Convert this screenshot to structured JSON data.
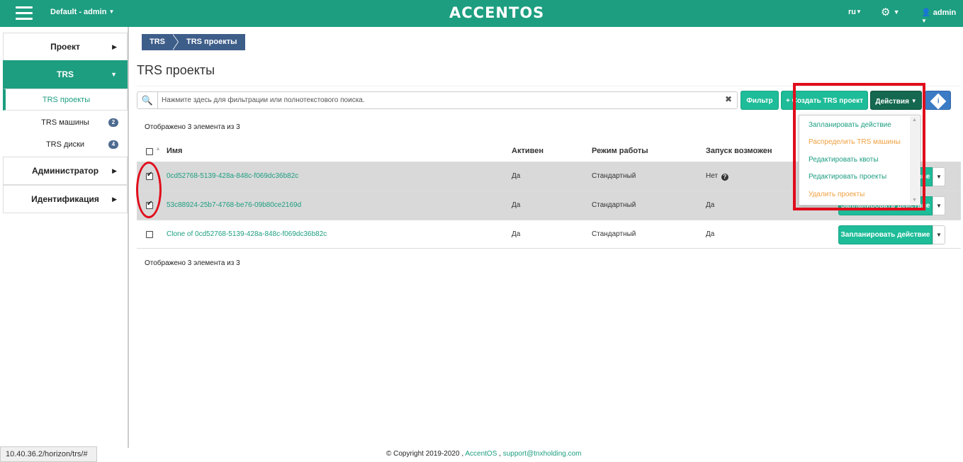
{
  "topbar": {
    "project": "Default - admin",
    "logo": "ACCENTOS",
    "lang": "ru",
    "user": "admin"
  },
  "sidebar": {
    "items": [
      {
        "label": "Проект"
      },
      {
        "label": "TRS"
      },
      {
        "label": "Администратор"
      },
      {
        "label": "Идентификация"
      }
    ],
    "sub_items": [
      {
        "label": "TRS проекты"
      },
      {
        "label": "TRS машины",
        "badge": "2"
      },
      {
        "label": "TRS диски",
        "badge": "4"
      }
    ]
  },
  "breadcrumb": [
    "TRS",
    "TRS проекты"
  ],
  "page_title": "TRS проекты",
  "search": {
    "placeholder": "Нажмите здесь для фильтрации или полнотекстового поиска.",
    "value": ""
  },
  "toolbar": {
    "filter": "Фильтр",
    "create": "Создать TRS проект",
    "actions": "Действия"
  },
  "count_text": "Отображено 3 элемента из 3",
  "table": {
    "headers": [
      "Имя",
      "Активен",
      "Режим работы",
      "Запуск возможен"
    ],
    "rows": [
      {
        "name": "0cd52768-5139-428a-848c-f069dc36b82c",
        "active": "Да",
        "mode": "Стандартный",
        "launch": "Нет",
        "selected": true
      },
      {
        "name": "53c88924-25b7-4768-be76-09b80ce2169d",
        "active": "Да",
        "mode": "Стандартный",
        "launch": "Да",
        "selected": true
      },
      {
        "name": "Clone of 0cd52768-5139-428a-848c-f069dc36b82c",
        "active": "Да",
        "mode": "Стандартный",
        "launch": "Да",
        "selected": false
      }
    ],
    "row_action": "Запланировать действие"
  },
  "dropdown": {
    "items": [
      {
        "label": "Запланировать действие",
        "color": "#1d9e80"
      },
      {
        "label": "Распределить TRS машины",
        "color": "#f0a040"
      },
      {
        "label": "Редактировать квоты",
        "color": "#1d9e80"
      },
      {
        "label": "Редактировать проекты",
        "color": "#1d9e80"
      },
      {
        "label": "Удалить проекты",
        "color": "#f0a040"
      }
    ]
  },
  "footer": {
    "copyright": "© Copyright 2019-2020 ,",
    "brand": "AccentOS",
    "sep": ",",
    "email": "support@tnxholding.com"
  },
  "statusbar": "10.40.36.2/horizon/trs/#",
  "colors": {
    "primary": "#1d9e80",
    "annotation": "#e00d1b",
    "breadcrumb": "#3e5e8a"
  }
}
